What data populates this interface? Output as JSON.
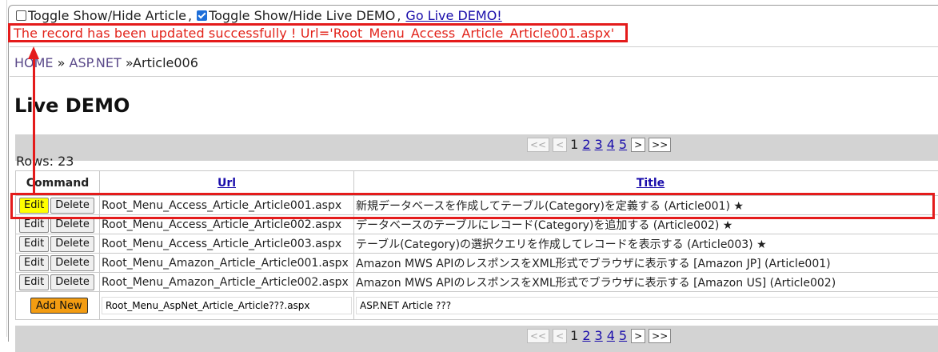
{
  "toggles": {
    "article_label": "Toggle Show/Hide Article",
    "article_checked": false,
    "demo_label": "Toggle Show/Hide Live DEMO",
    "demo_checked": true,
    "separator": ",",
    "go_live_link": "Go Live DEMO!"
  },
  "message": "The record has been updated successfully ! Url='Root_Menu_Access_Article_Article001.aspx'",
  "breadcrumb": {
    "home": "HOME",
    "sep": "»",
    "aspnet": "ASP.NET",
    "current": "»Article006"
  },
  "title": "Live DEMO",
  "pager": {
    "first": "<<",
    "prev": "<",
    "pages": [
      "1",
      "2",
      "3",
      "4",
      "5"
    ],
    "current": "1",
    "next": ">",
    "last": ">>"
  },
  "rows_label": "Rows: 23",
  "table": {
    "headers": {
      "command": "Command",
      "url": "Url",
      "title": "Title"
    },
    "edit_label": "Edit",
    "delete_label": "Delete",
    "rows": [
      {
        "url": "Root_Menu_Access_Article_Article001.aspx",
        "title": "新規データベースを作成してテーブル(Category)を定義する (Article001) ★",
        "highlighted": true
      },
      {
        "url": "Root_Menu_Access_Article_Article002.aspx",
        "title": "データベースのテーブルにレコード(Category)を追加する (Article002) ★",
        "highlighted": false
      },
      {
        "url": "Root_Menu_Access_Article_Article003.aspx",
        "title": "テーブル(Category)の選択クエリを作成してレコードを表示する (Article003) ★",
        "highlighted": false
      },
      {
        "url": "Root_Menu_Amazon_Article_Article001.aspx",
        "title": "Amazon MWS APIのレスポンスをXML形式でブラウザに表示する [Amazon JP] (Article001)",
        "highlighted": false
      },
      {
        "url": "Root_Menu_Amazon_Article_Article002.aspx",
        "title": "Amazon MWS APIのレスポンスをXML形式でブラウザに表示する [Amazon US] (Article002)",
        "highlighted": false
      }
    ],
    "new_row": {
      "add_label": "Add New",
      "url_value": "Root_Menu_AspNet_Article_Article???.aspx",
      "title_value": "ASP.NET Article ???"
    }
  },
  "colors": {
    "annotation": "#e41b1b",
    "message_text": "#e2231a",
    "edit_highlight": "#ffff00",
    "add_new": "#f39c12",
    "pager_bar": "#d3d3d3"
  }
}
